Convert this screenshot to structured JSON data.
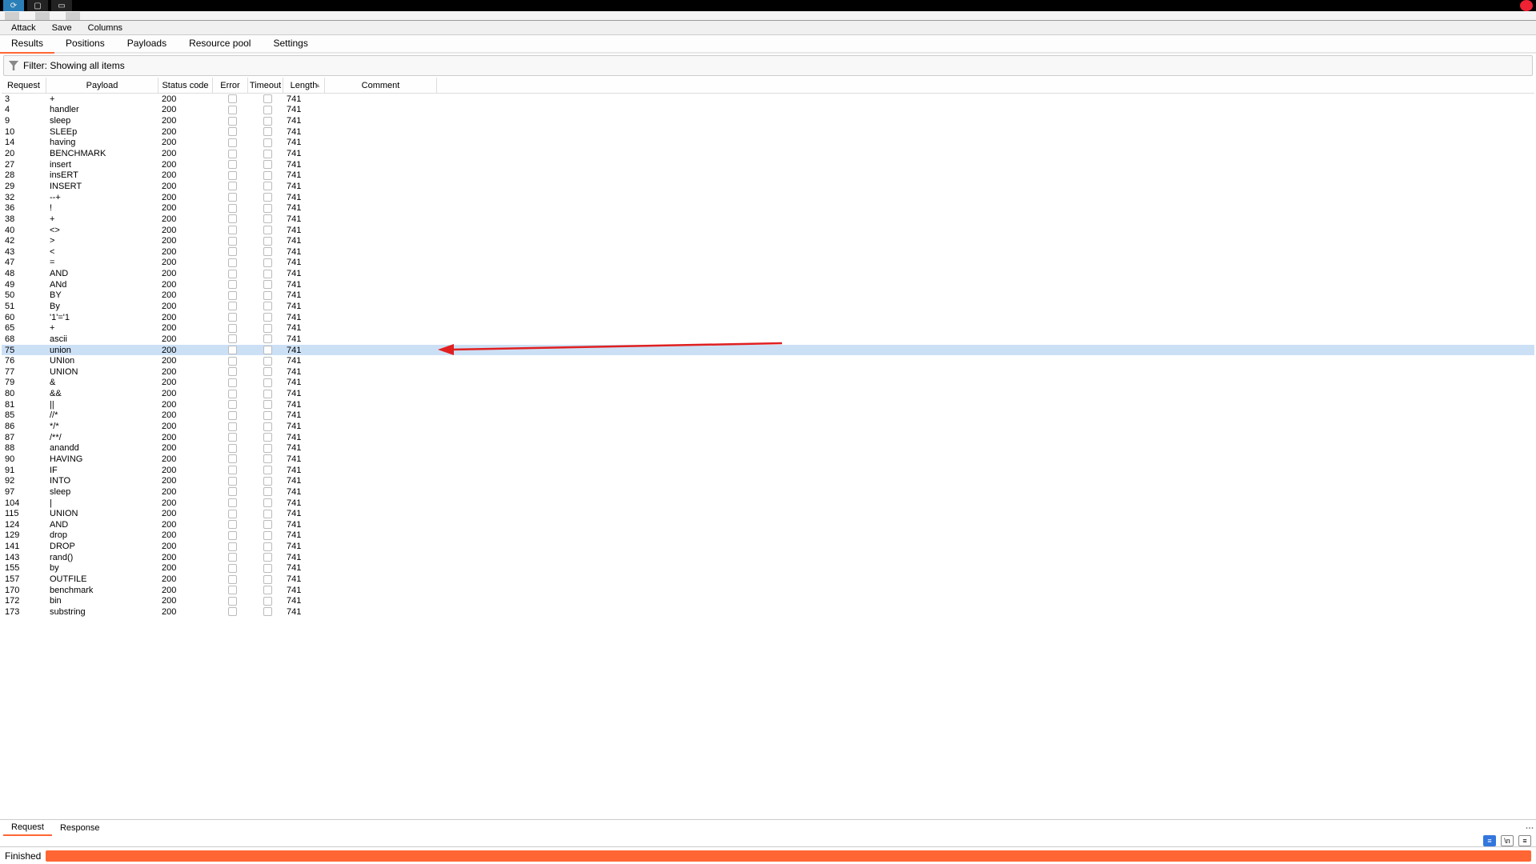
{
  "menu": {
    "attack": "Attack",
    "save": "Save",
    "columns": "Columns"
  },
  "tabs": {
    "results": "Results",
    "positions": "Positions",
    "payloads": "Payloads",
    "resource_pool": "Resource pool",
    "settings": "Settings"
  },
  "filter": {
    "label": "Filter: Showing all items"
  },
  "headers": {
    "request": "Request",
    "payload": "Payload",
    "status": "Status code",
    "error": "Error",
    "timeout": "Timeout",
    "length": "Length",
    "comment": "Comment"
  },
  "sort_indicator": "▲",
  "rows": [
    {
      "req": "3",
      "pay": "+",
      "stat": "200",
      "len": "741"
    },
    {
      "req": "4",
      "pay": "handler",
      "stat": "200",
      "len": "741"
    },
    {
      "req": "9",
      "pay": "sleep",
      "stat": "200",
      "len": "741"
    },
    {
      "req": "10",
      "pay": "SLEEp",
      "stat": "200",
      "len": "741"
    },
    {
      "req": "14",
      "pay": "having",
      "stat": "200",
      "len": "741"
    },
    {
      "req": "20",
      "pay": "BENCHMARK",
      "stat": "200",
      "len": "741"
    },
    {
      "req": "27",
      "pay": "insert",
      "stat": "200",
      "len": "741"
    },
    {
      "req": "28",
      "pay": "insERT",
      "stat": "200",
      "len": "741"
    },
    {
      "req": "29",
      "pay": "INSERT",
      "stat": "200",
      "len": "741"
    },
    {
      "req": "32",
      "pay": "--+",
      "stat": "200",
      "len": "741"
    },
    {
      "req": "36",
      "pay": "!",
      "stat": "200",
      "len": "741"
    },
    {
      "req": "38",
      "pay": "+",
      "stat": "200",
      "len": "741"
    },
    {
      "req": "40",
      "pay": "<>",
      "stat": "200",
      "len": "741"
    },
    {
      "req": "42",
      "pay": ">",
      "stat": "200",
      "len": "741"
    },
    {
      "req": "43",
      "pay": "<",
      "stat": "200",
      "len": "741"
    },
    {
      "req": "47",
      "pay": "=",
      "stat": "200",
      "len": "741"
    },
    {
      "req": "48",
      "pay": "AND",
      "stat": "200",
      "len": "741"
    },
    {
      "req": "49",
      "pay": "ANd",
      "stat": "200",
      "len": "741"
    },
    {
      "req": "50",
      "pay": "BY",
      "stat": "200",
      "len": "741"
    },
    {
      "req": "51",
      "pay": "By",
      "stat": "200",
      "len": "741"
    },
    {
      "req": "60",
      "pay": "'1'='1",
      "stat": "200",
      "len": "741"
    },
    {
      "req": "65",
      "pay": "+",
      "stat": "200",
      "len": "741"
    },
    {
      "req": "68",
      "pay": "ascii",
      "stat": "200",
      "len": "741"
    },
    {
      "req": "75",
      "pay": "union",
      "stat": "200",
      "len": "741",
      "selected": true
    },
    {
      "req": "76",
      "pay": "UNIon",
      "stat": "200",
      "len": "741"
    },
    {
      "req": "77",
      "pay": "UNION",
      "stat": "200",
      "len": "741"
    },
    {
      "req": "79",
      "pay": "&",
      "stat": "200",
      "len": "741"
    },
    {
      "req": "80",
      "pay": "&&",
      "stat": "200",
      "len": "741"
    },
    {
      "req": "81",
      "pay": "||",
      "stat": "200",
      "len": "741"
    },
    {
      "req": "85",
      "pay": "//*",
      "stat": "200",
      "len": "741"
    },
    {
      "req": "86",
      "pay": "*/*",
      "stat": "200",
      "len": "741"
    },
    {
      "req": "87",
      "pay": "/**/",
      "stat": "200",
      "len": "741"
    },
    {
      "req": "88",
      "pay": "anandd",
      "stat": "200",
      "len": "741"
    },
    {
      "req": "90",
      "pay": "HAVING",
      "stat": "200",
      "len": "741"
    },
    {
      "req": "91",
      "pay": "IF",
      "stat": "200",
      "len": "741"
    },
    {
      "req": "92",
      "pay": "INTO",
      "stat": "200",
      "len": "741"
    },
    {
      "req": "97",
      "pay": "sleep",
      "stat": "200",
      "len": "741"
    },
    {
      "req": "104",
      "pay": "|",
      "stat": "200",
      "len": "741"
    },
    {
      "req": "115",
      "pay": "UNION",
      "stat": "200",
      "len": "741"
    },
    {
      "req": "124",
      "pay": "AND",
      "stat": "200",
      "len": "741"
    },
    {
      "req": "129",
      "pay": "drop",
      "stat": "200",
      "len": "741"
    },
    {
      "req": "141",
      "pay": "DROP",
      "stat": "200",
      "len": "741"
    },
    {
      "req": "143",
      "pay": "rand()",
      "stat": "200",
      "len": "741"
    },
    {
      "req": "155",
      "pay": "by",
      "stat": "200",
      "len": "741"
    },
    {
      "req": "157",
      "pay": "OUTFILE",
      "stat": "200",
      "len": "741"
    },
    {
      "req": "170",
      "pay": "benchmark",
      "stat": "200",
      "len": "741"
    },
    {
      "req": "172",
      "pay": "bin",
      "stat": "200",
      "len": "741"
    },
    {
      "req": "173",
      "pay": "substring",
      "stat": "200",
      "len": "741"
    }
  ],
  "bottom_tabs": {
    "request": "Request",
    "response": "Response"
  },
  "status": {
    "finished": "Finished"
  },
  "view_icons": {
    "render": "≡",
    "newline": "\\n",
    "list": "≡"
  }
}
